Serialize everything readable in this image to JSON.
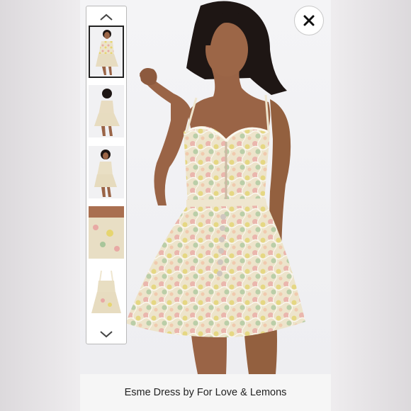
{
  "listing": {
    "caption": "Esme Dress by For Love & Lemons"
  },
  "thumbnails": {
    "count_visible": 5,
    "selected_index": 0,
    "items": [
      {
        "view": "front-full"
      },
      {
        "view": "back-full"
      },
      {
        "view": "side-full"
      },
      {
        "view": "bodice-closeup"
      },
      {
        "view": "flat-lay"
      }
    ]
  },
  "icons": {
    "close": "close-icon",
    "up": "chevron-up-icon",
    "down": "chevron-down-icon"
  },
  "colors": {
    "dress_base": "#ece3c9",
    "floral_pink": "#e8a9a4",
    "floral_yellow": "#e6d56f",
    "floral_green": "#a8c59a",
    "skin": "#9a6446",
    "hair": "#1e1614"
  }
}
